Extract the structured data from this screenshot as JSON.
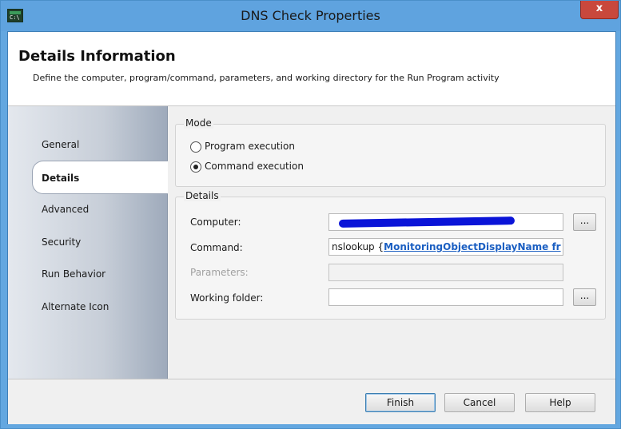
{
  "window": {
    "title": "DNS Check Properties",
    "close_label": "x",
    "app_icon": "console-icon"
  },
  "header": {
    "title": "Details Information",
    "description": "Define the computer, program/command, parameters, and working directory for the Run Program activity"
  },
  "nav": {
    "items": [
      {
        "label": "General"
      },
      {
        "label": "Details"
      },
      {
        "label": "Advanced"
      },
      {
        "label": "Security"
      },
      {
        "label": "Run Behavior"
      },
      {
        "label": "Alternate Icon"
      }
    ],
    "selected": "Details"
  },
  "mode": {
    "group_label": "Mode",
    "options": [
      {
        "label": "Program execution",
        "checked": false
      },
      {
        "label": "Command execution",
        "checked": true
      }
    ]
  },
  "details": {
    "group_label": "Details",
    "computer": {
      "label": "Computer:",
      "value": "",
      "browse_label": "..."
    },
    "command": {
      "label": "Command:",
      "value_prefix": "nslookup {",
      "value_token": "MonitoringObjectDisplayName fr"
    },
    "parameters": {
      "label": "Parameters:",
      "value": ""
    },
    "working_folder": {
      "label": "Working folder:",
      "value": "",
      "browse_label": "..."
    }
  },
  "buttons": {
    "finish": "Finish",
    "cancel": "Cancel",
    "help": "Help"
  },
  "colors": {
    "titlebar": "#5fa3df",
    "close": "#c9483c",
    "link": "#1b5fc2",
    "redaction": "#0a14d8"
  }
}
